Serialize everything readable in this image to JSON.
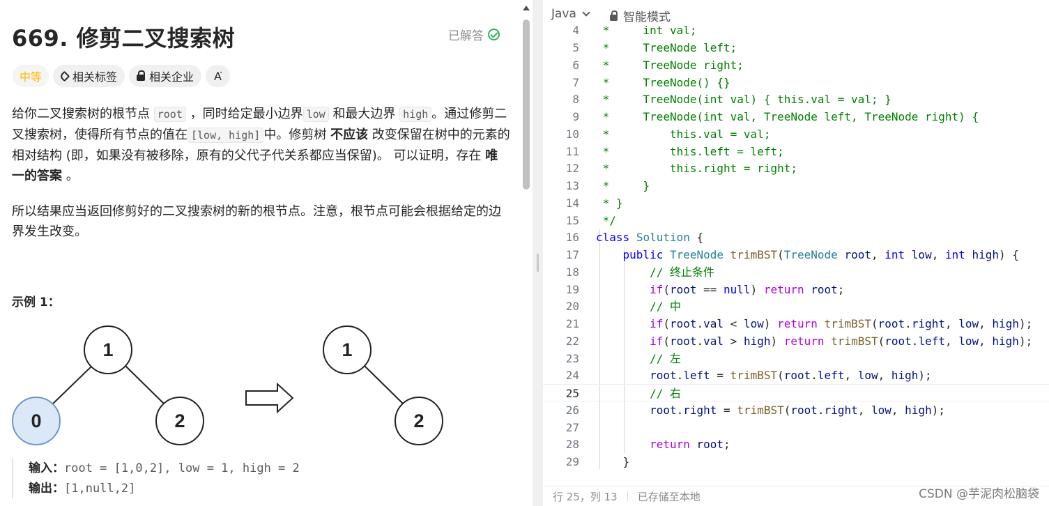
{
  "problem": {
    "title": "669. 修剪二叉搜索树",
    "status": "已解答",
    "tags": {
      "difficulty": "中等",
      "related_tags": "相关标签",
      "related_companies": "相关企业",
      "translate": "A͘"
    },
    "description": {
      "p1_a": "给你二叉搜索树的根节点 ",
      "p1_code_root": "root",
      "p1_b": " ，同时给定最小边界",
      "p1_code_low": "low",
      "p1_c": " 和最大边界 ",
      "p1_code_high": "high",
      "p1_d": "。通过修剪二叉搜索树，使得所有节点的值在",
      "p1_code_range": "[low, high]",
      "p1_e": "中。修剪树 ",
      "p1_bold_1": "不应该",
      "p1_f": " 改变保留在树中的元素的相对结构 (即，如果没有被移除，原有的父代子代关系都应当保留)。 可以证明，存在 ",
      "p1_bold_2": "唯一的答案",
      "p1_g": " 。",
      "p2": "所以结果应当返回修剪好的二叉搜索树的新的根节点。注意，根节点可能会根据给定的边界发生改变。"
    },
    "example": {
      "title": "示例 1：",
      "input_label": "输入：",
      "input_value": "root = [1,0,2], low = 1, high = 2",
      "output_label": "输出：",
      "output_value": "[1,null,2]",
      "before_tree": {
        "root": "1",
        "left": "0",
        "right": "2"
      },
      "after_tree": {
        "root": "1",
        "right": "2"
      }
    }
  },
  "editor": {
    "language": "Java",
    "mode": "智能模式",
    "current_line": 25,
    "lines": [
      {
        "n": "4"
      },
      {
        "n": "5"
      },
      {
        "n": "6"
      },
      {
        "n": "7"
      },
      {
        "n": "8"
      },
      {
        "n": "9"
      },
      {
        "n": "10"
      },
      {
        "n": "11"
      },
      {
        "n": "12"
      },
      {
        "n": "13"
      },
      {
        "n": "14"
      },
      {
        "n": "15"
      },
      {
        "n": "16"
      },
      {
        "n": "17"
      },
      {
        "n": "18"
      },
      {
        "n": "19"
      },
      {
        "n": "20"
      },
      {
        "n": "21"
      },
      {
        "n": "22"
      },
      {
        "n": "23"
      },
      {
        "n": "24"
      },
      {
        "n": "25"
      },
      {
        "n": "26"
      },
      {
        "n": "27"
      },
      {
        "n": "28"
      },
      {
        "n": "29"
      }
    ],
    "code": {
      "l4": " *     int val;",
      "l5": " *     TreeNode left;",
      "l6": " *     TreeNode right;",
      "l7": " *     TreeNode() {}",
      "l8": " *     TreeNode(int val) { this.val = val; }",
      "l9": " *     TreeNode(int val, TreeNode left, TreeNode right) {",
      "l10": " *         this.val = val;",
      "l11": " *         this.left = left;",
      "l12": " *         this.right = right;",
      "l13": " *     }",
      "l14": " * }",
      "l15": " */",
      "l18": "// 终止条件",
      "l20": "// 中",
      "l23": "// 左",
      "l25": "// 右"
    },
    "status": {
      "position": "行 25，列 13",
      "saved": "已存储至本地"
    }
  },
  "watermark": "CSDN @芋泥肉松脑袋"
}
